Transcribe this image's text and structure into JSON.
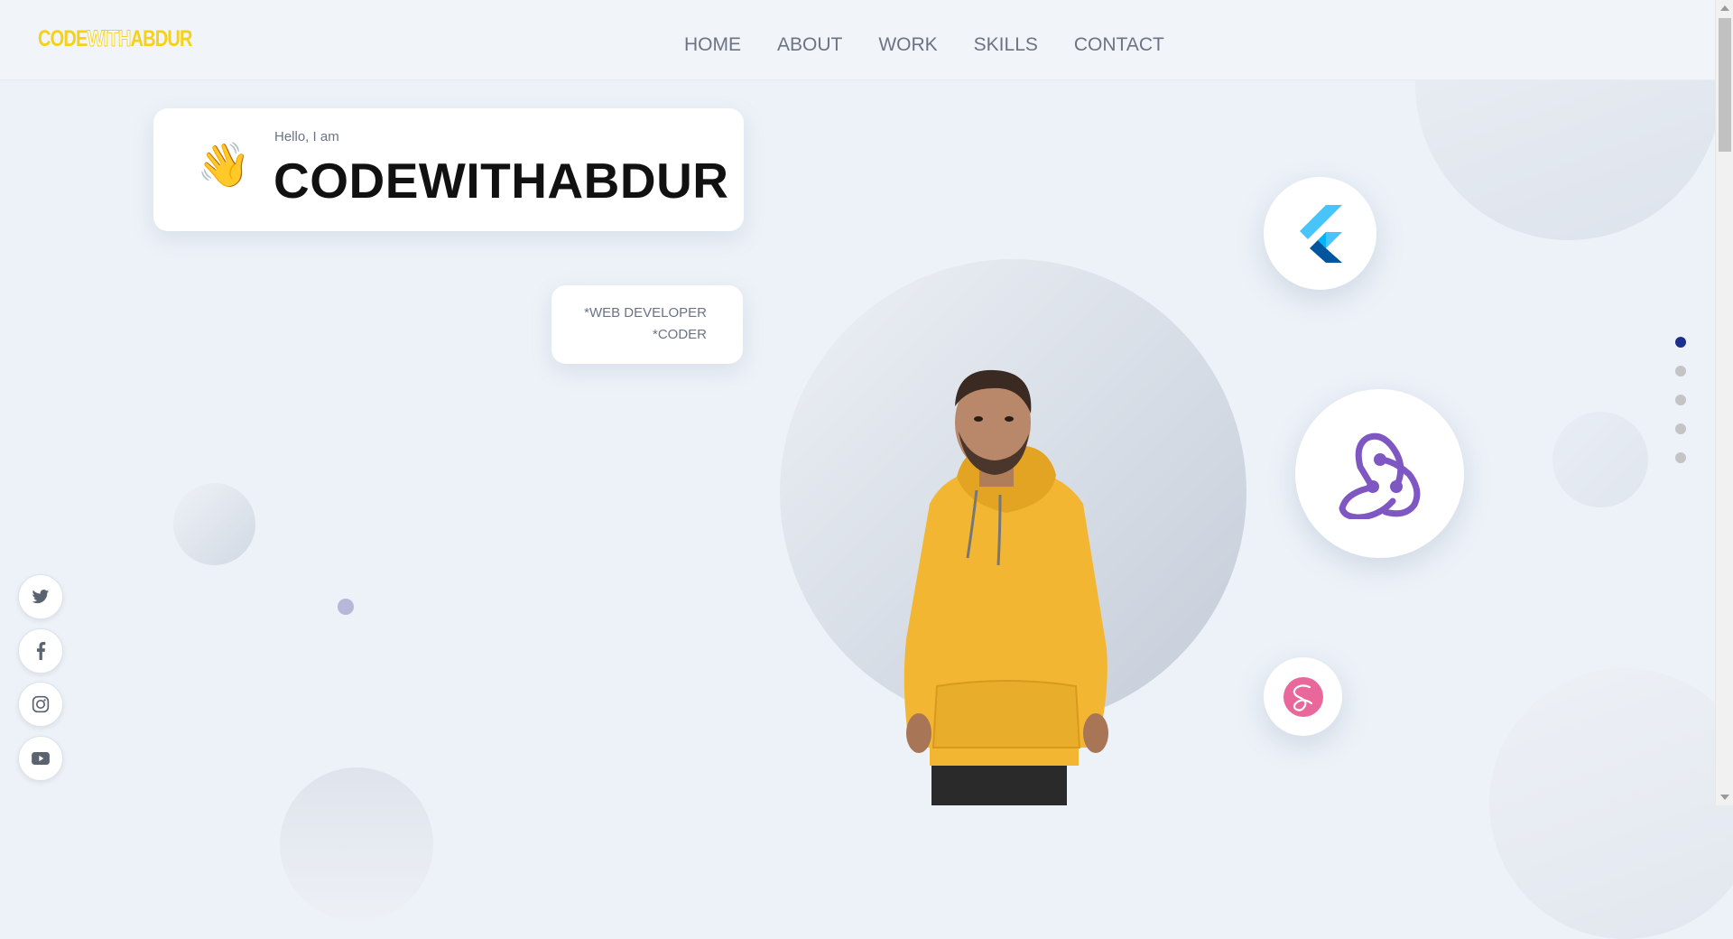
{
  "brand": {
    "logo_part1": "CODE",
    "logo_part2": "WITH",
    "logo_part3": "ABDUR",
    "accent": "#f5d117"
  },
  "nav": {
    "items": [
      {
        "label": "HOME"
      },
      {
        "label": "ABOUT"
      },
      {
        "label": "WORK"
      },
      {
        "label": "SKILLS"
      },
      {
        "label": "CONTACT"
      }
    ]
  },
  "hero": {
    "greeting_icon": "waving-hand-icon",
    "greeting_small": "Hello, I am",
    "name": "CODEWITHABDUR",
    "roles": [
      "*WEB DEVELOPER",
      "*CODER"
    ]
  },
  "skills": {
    "icons": [
      "flutter-icon",
      "redux-icon",
      "sass-icon"
    ]
  },
  "pagination": {
    "total": 5,
    "active": 1,
    "active_color": "#1c2f8e"
  },
  "social": {
    "icons": [
      "twitter-icon",
      "facebook-icon",
      "instagram-icon",
      "youtube-icon"
    ]
  }
}
